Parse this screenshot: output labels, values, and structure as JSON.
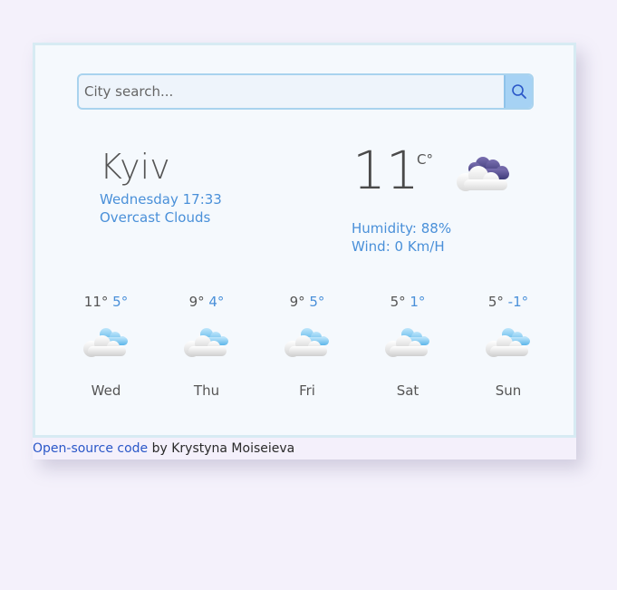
{
  "search": {
    "placeholder": "City search...",
    "button_icon": "search-icon"
  },
  "current": {
    "city": "Kyiv",
    "datetime": "Wednesday 17:33",
    "description": "Overcast Clouds",
    "temperature": "11",
    "unit": "C°",
    "humidity": "Humidity: 88%",
    "wind": "Wind: 0 Km/H",
    "icon": "overcast-clouds-icon"
  },
  "forecast": [
    {
      "day": "Wed",
      "high": "11°",
      "low": "5°",
      "icon": "cloud-icon"
    },
    {
      "day": "Thu",
      "high": "9°",
      "low": "4°",
      "icon": "cloud-icon"
    },
    {
      "day": "Fri",
      "high": "9°",
      "low": "5°",
      "icon": "cloud-icon"
    },
    {
      "day": "Sat",
      "high": "5°",
      "low": "1°",
      "icon": "cloud-icon"
    },
    {
      "day": "Sun",
      "high": "5°",
      "low": "-1°",
      "icon": "cloud-icon"
    }
  ],
  "footer": {
    "link_text": "Open-source code",
    "author_text": " by Krystyna Moiseieva"
  },
  "colors": {
    "accent": "#4a90d9",
    "background": "#f4f1fb",
    "card": "#f5f9fd",
    "link": "#2a57c8"
  }
}
